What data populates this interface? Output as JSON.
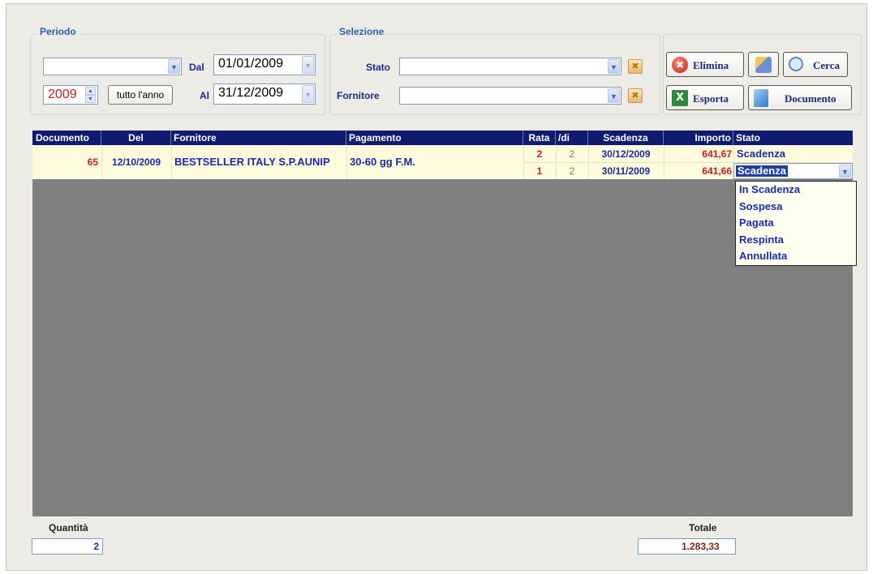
{
  "periodo": {
    "legend": "Periodo",
    "dal_label": "Dal",
    "al_label": "Al",
    "year": "2009",
    "tutto_button": "tutto l'anno",
    "dal_value": "01/01/2009",
    "al_value": "31/12/2009"
  },
  "selezione": {
    "legend": "Selezione",
    "stato_label": "Stato",
    "fornitore_label": "Fornitore"
  },
  "toolbar": {
    "elimina": "Elimina",
    "cerca": "Cerca",
    "esporta": "Esporta",
    "documento": "Documento"
  },
  "grid": {
    "headers": [
      "Documento",
      "Del",
      "Fornitore",
      "Pagamento",
      "Rata",
      "/di",
      "Scadenza",
      "Importo",
      "Stato"
    ],
    "record": {
      "documento": "65",
      "del": "12/10/2009",
      "fornitore": "BESTSELLER ITALY S.P.AUNIP",
      "pagamento": "30-60 gg F.M."
    },
    "rates": [
      {
        "rata": "2",
        "di": "2",
        "scadenza": "30/12/2009",
        "importo": "641,67",
        "stato": "Scadenza"
      },
      {
        "rata": "1",
        "di": "2",
        "scadenza": "30/11/2009",
        "importo": "641,66",
        "stato": "Scadenza"
      }
    ]
  },
  "stato_options": [
    "In Scadenza",
    "Sospesa",
    "Pagata",
    "Respinta",
    "Annullata"
  ],
  "footer": {
    "quantita_label": "Quantità",
    "quantita_value": "2",
    "totale_label": "Totale",
    "totale_value": "1.283,33"
  },
  "colors": {
    "header_bg": "#0e1b70",
    "grid_bg": "#808080",
    "row_bg": "#fdfbdc",
    "accent_red": "#c62020",
    "accent_blue": "#1c2aa8"
  }
}
